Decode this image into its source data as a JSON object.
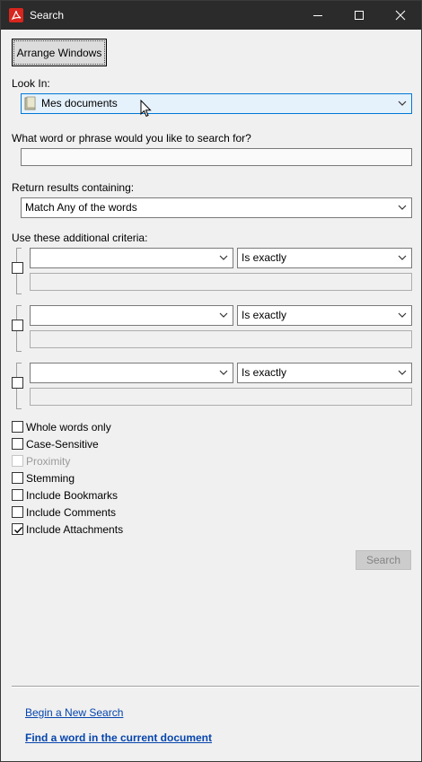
{
  "window": {
    "title": "Search",
    "accent": "#0078d7",
    "titlebar_color": "#2b2b2b",
    "app_icon_color": "#d7261e"
  },
  "toolbar": {
    "arrange_label": "Arrange Windows"
  },
  "look_in": {
    "label": "Look In:",
    "value": "Mes documents",
    "icon": "folder-icon"
  },
  "query": {
    "label": "What word or phrase would you like to search for?",
    "value": ""
  },
  "return_results": {
    "label": "Return results containing:",
    "value": "Match Any of the words"
  },
  "criteria": {
    "label": "Use these additional criteria:",
    "rows": [
      {
        "field": "",
        "operator": "Is exactly",
        "value": "",
        "checked": false
      },
      {
        "field": "",
        "operator": "Is exactly",
        "value": "",
        "checked": false
      },
      {
        "field": "",
        "operator": "Is exactly",
        "value": "",
        "checked": false
      }
    ]
  },
  "options": [
    {
      "label": "Whole words only",
      "checked": false,
      "disabled": false
    },
    {
      "label": "Case-Sensitive",
      "checked": false,
      "disabled": false
    },
    {
      "label": "Proximity",
      "checked": false,
      "disabled": true
    },
    {
      "label": "Stemming",
      "checked": false,
      "disabled": false
    },
    {
      "label": "Include Bookmarks",
      "checked": false,
      "disabled": false
    },
    {
      "label": "Include Comments",
      "checked": false,
      "disabled": false
    },
    {
      "label": "Include Attachments",
      "checked": true,
      "disabled": false
    }
  ],
  "search_button": {
    "label": "Search"
  },
  "links": {
    "new_search": "Begin a New Search",
    "find_current": "Find a word in the current document"
  }
}
